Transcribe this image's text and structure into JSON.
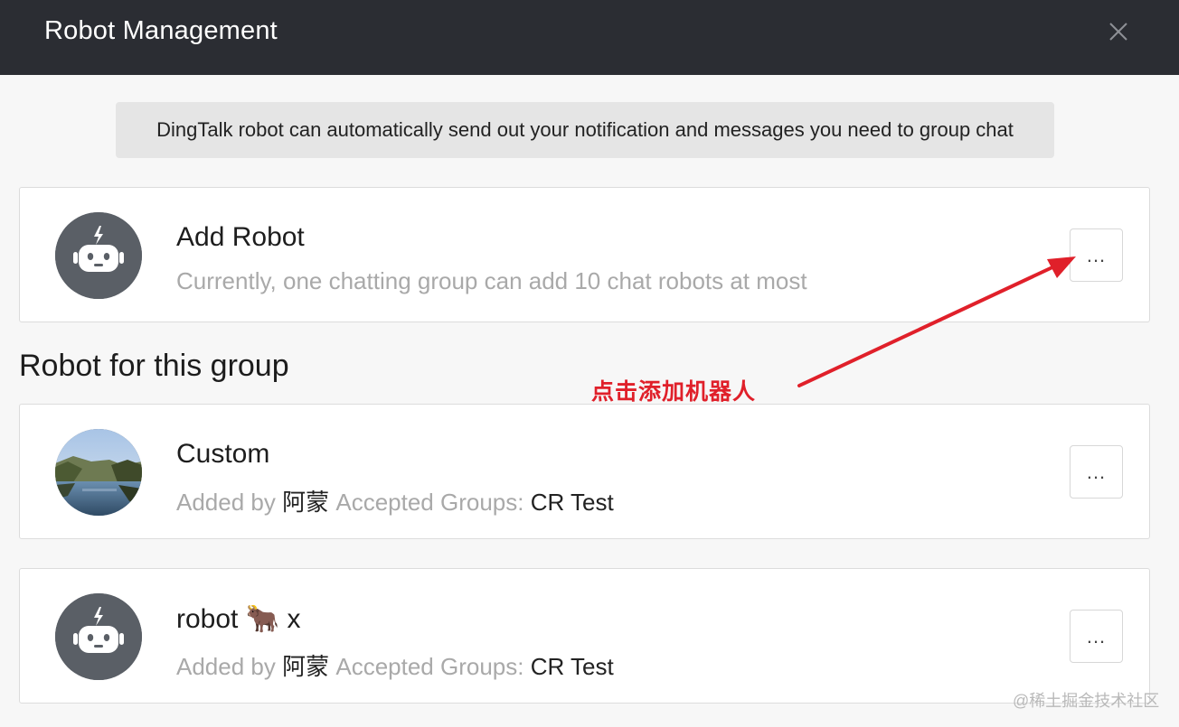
{
  "window": {
    "title": "Robot Management",
    "close_icon": "close-icon"
  },
  "notice": "DingTalk robot can automatically send out your notification and messages you need to group chat",
  "add_robot": {
    "name": "Add Robot",
    "description": "Currently, one chatting group can add 10 chat robots at most",
    "more_label": "...",
    "icon": "robot-icon"
  },
  "section_title": "Robot for this group",
  "robots": [
    {
      "name": "Custom",
      "added_by_label": "Added by",
      "added_by": "阿蒙",
      "groups_label": "Accepted Groups:",
      "groups": "CR Test",
      "more_label": "...",
      "avatar": "landscape-photo"
    },
    {
      "name_prefix": "robot",
      "name_emoji": "🐂",
      "name_suffix": "x",
      "added_by_label": "Added by",
      "added_by": "阿蒙",
      "groups_label": "Accepted Groups:",
      "groups": "CR Test",
      "more_label": "...",
      "avatar": "robot-icon"
    }
  ],
  "annotation": {
    "text": "点击添加机器人",
    "color": "#e0202a"
  },
  "watermark": "@稀土掘金技术社区",
  "colors": {
    "titlebar": "#2b2d33",
    "avatar_gray": "#5a5f66",
    "subtle_text": "#a9a9a9"
  }
}
